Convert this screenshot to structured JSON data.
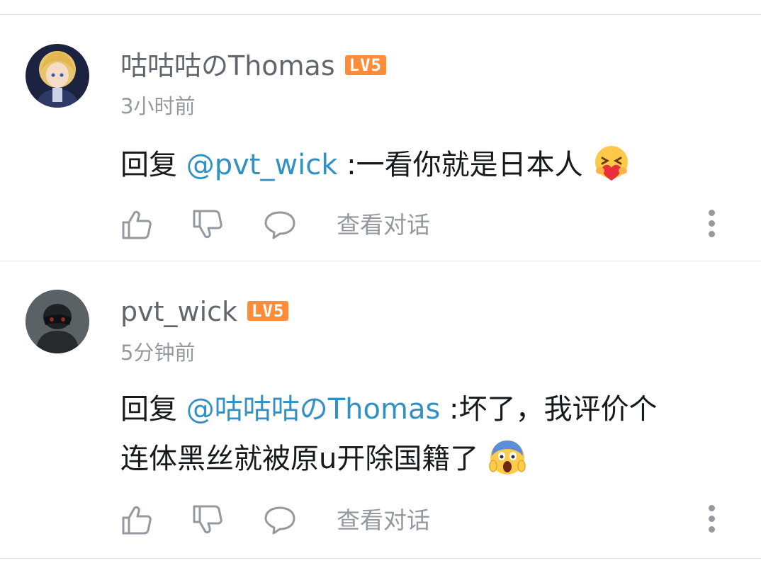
{
  "comments": [
    {
      "username": "咕咕咕のThomas",
      "level": "LV5",
      "time": "3小时前",
      "reply_prefix": "回复 ",
      "mention": "@pvt_wick",
      "text_line1": " :一看你就是日本人",
      "text_line2": "",
      "emoji": "hug-emoji",
      "view_conversation": "查看对话"
    },
    {
      "username": "pvt_wick",
      "level": "LV5",
      "time": "5分钟前",
      "reply_prefix": "回复 ",
      "mention": "@咕咕咕のThomas",
      "text_line1": " :坏了，我评价个",
      "text_line2": "连体黑丝就被原u开除国籍了",
      "emoji": "scream-emoji",
      "view_conversation": "查看对话"
    }
  ],
  "colors": {
    "mention": "#3190c4",
    "level_badge": "#ff8c38",
    "secondary_text": "#9499a0",
    "username": "#61666d"
  }
}
